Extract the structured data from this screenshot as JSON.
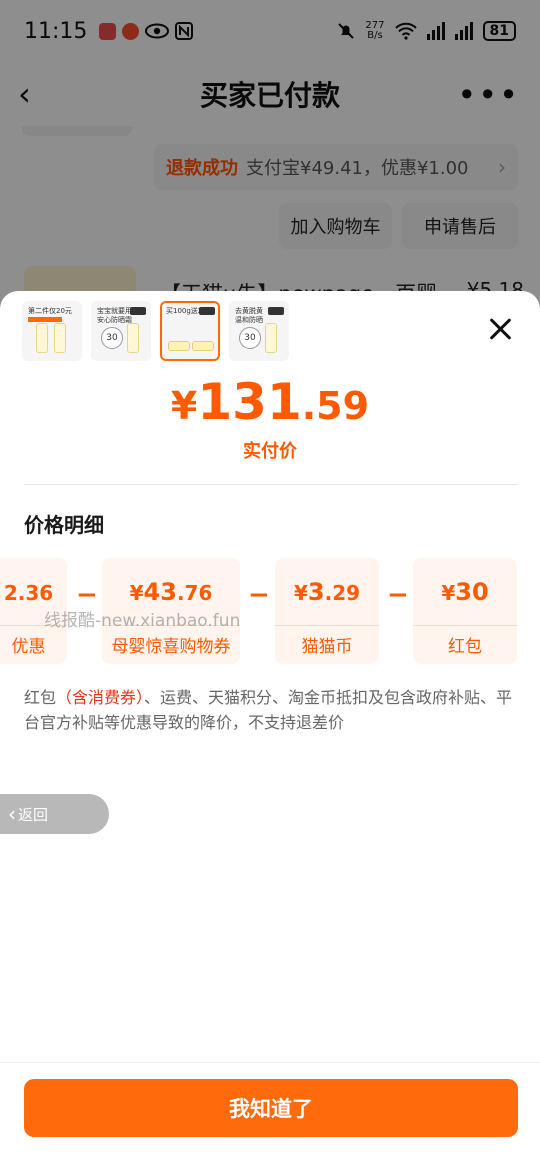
{
  "status_bar": {
    "time": "11:15",
    "net_speed_value": "277",
    "net_speed_unit": "B/s",
    "network": "6",
    "battery": "81"
  },
  "nav": {
    "title": "买家已付款",
    "back_icon": "chevron-left-icon",
    "more_icon": "more-dots-icon"
  },
  "background": {
    "refund_status": "退款成功",
    "refund_detail": "支付宝¥49.41，优惠¥1.00",
    "add_cart_label": "加入购物车",
    "after_sale_label": "申请售后",
    "product_title": "【天猫u先】newpage一页婴",
    "product_price": "¥5.18"
  },
  "sheet": {
    "thumbnails": [
      {
        "top_text": "第二件仅20元",
        "band": "限时价 · 立即抢购"
      },
      {
        "top_text": "宝宝就要用 安心防晒霜",
        "badge": "30"
      },
      {
        "top_text": "买100g送200g",
        "badge": "30"
      },
      {
        "top_text": "去黄脱黄 温和防晒",
        "badge": "30"
      }
    ],
    "active_thumbnail": 2,
    "price_currency": "¥",
    "price_int": "131",
    "price_dec": ".59",
    "price_label": "实付价",
    "section_title": "价格明细",
    "breakdown": [
      {
        "amount": "2.36",
        "label": "优惠"
      },
      {
        "currency": "¥",
        "amount_int": "43",
        "amount_dec": ".76",
        "label": "母婴惊喜购物券"
      },
      {
        "currency": "¥",
        "amount_int": "3",
        "amount_dec": ".29",
        "label": "猫猫币"
      },
      {
        "currency": "¥",
        "amount_int": "30",
        "amount_dec": "",
        "label": "红包"
      }
    ],
    "minus_sign": "−",
    "watermark": "线报酷-new.xianbao.fun",
    "note": {
      "part1": "红包",
      "highlight": "（含消费券）",
      "part2": "、运费、天猫积分、淘金币抵扣及包含政府补贴、平台官方补贴等优惠导致的降价，不支持退差价"
    },
    "float_back_label": "返回",
    "confirm_label": "我知道了"
  },
  "colors": {
    "accent": "#ff5a00",
    "button": "#ff6a0d",
    "card_bg": "#fff4ee"
  }
}
